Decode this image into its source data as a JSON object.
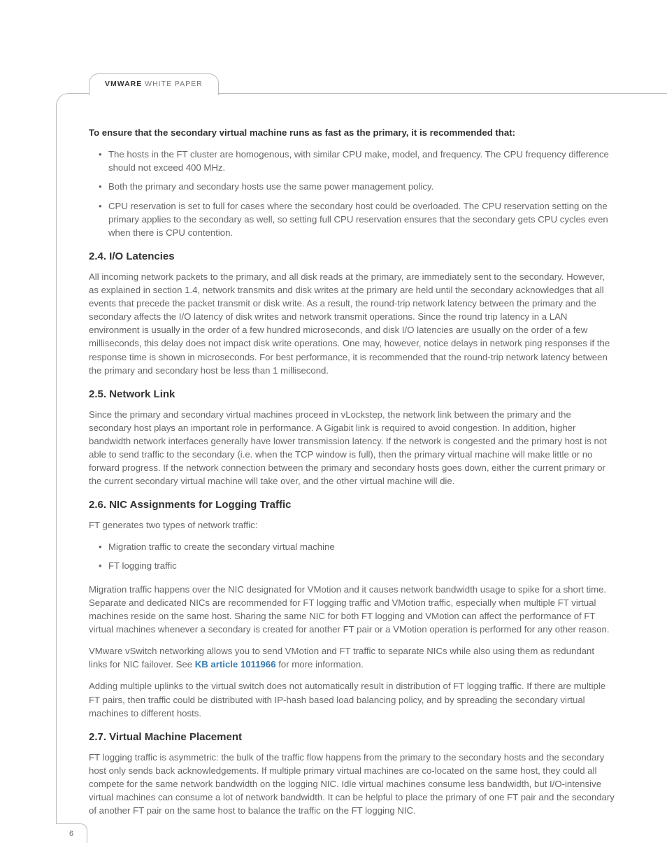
{
  "header": {
    "brand": "VMWARE",
    "doctype": "WHITE PAPER"
  },
  "intro": "To ensure that the secondary virtual machine runs as fast as the primary, it is recommended that:",
  "intro_items": [
    "The hosts in the FT cluster are homogenous, with similar CPU make, model, and frequency. The CPU frequency difference should not exceed 400 MHz.",
    "Both the primary and secondary hosts use the same power management policy.",
    "CPU reservation is set to full for cases where the secondary host could be overloaded. The CPU reservation setting on the primary applies to the secondary as well, so setting full CPU reservation ensures that the secondary gets CPU cycles even when there is CPU contention."
  ],
  "s24": {
    "title": "2.4. I/O Latencies",
    "body": "All incoming network packets to the primary, and all disk reads at the primary, are immediately sent to the secondary. However, as explained in section 1.4, network transmits and disk writes at the primary are held until the secondary acknowledges that all events that precede the packet transmit or disk write. As a result, the round-trip network latency between the primary and the secondary affects the I/O latency of disk writes and network transmit operations. Since the round trip latency in a LAN environment is usually in the order of a few hundred microseconds, and disk I/O latencies are usually on the order of a few milliseconds, this delay does not impact disk write operations. One may, however, notice delays in network ping responses if the response time is shown in microseconds. For best performance, it is recommended that the round-trip network latency between the primary and secondary host be less than 1 millisecond."
  },
  "s25": {
    "title": "2.5. Network Link",
    "body": "Since the primary and secondary virtual machines proceed in vLockstep, the network link between the primary and the secondary host plays an important role in performance. A Gigabit link is required to avoid congestion. In addition, higher bandwidth network interfaces generally have lower transmission latency. If the network is congested and the primary host is not able to send traffic to the secondary (i.e. when the TCP window is full), then the primary virtual machine will make little or no forward progress. If the network connection between the primary and secondary hosts goes down, either the current primary or the current secondary virtual machine will take over, and the other virtual machine will die."
  },
  "s26": {
    "title": "2.6. NIC Assignments for Logging Traffic",
    "lead": "FT generates two types of network traffic:",
    "items": [
      "Migration traffic to create the secondary virtual machine",
      "FT logging traffic"
    ],
    "p1": "Migration traffic happens over the NIC designated for VMotion and it causes network bandwidth usage to spike for a short time. Separate and dedicated NICs are recommended for FT logging traffic and VMotion traffic, especially when multiple FT virtual machines reside on the same host. Sharing the same NIC for both FT logging and VMotion can affect the performance of FT virtual machines whenever a secondary is created for another FT pair or a VMotion operation is performed for any other reason.",
    "p2a": "VMware vSwitch networking allows you to send VMotion and FT traffic to separate NICs while also using them as redundant links for NIC failover. See ",
    "p2link": "KB article 1011966",
    "p2b": " for more information.",
    "p3": "Adding multiple uplinks to the virtual switch does not automatically result in distribution of FT logging traffic. If there are multiple FT pairs, then traffic could be distributed with IP-hash based load balancing policy, and by spreading the secondary virtual machines to different hosts."
  },
  "s27": {
    "title": "2.7. Virtual Machine Placement",
    "body": "FT logging traffic is asymmetric: the bulk of the traffic flow happens from the primary to the secondary hosts and the secondary host only sends back acknowledgements. If multiple primary virtual machines are co-located on the same host, they could all compete for the same network bandwidth on the logging NIC. Idle virtual machines consume less bandwidth, but I/O-intensive virtual machines can consume a lot of network bandwidth. It can be helpful to place the primary of one FT pair and the secondary of another FT pair on the same host to balance the traffic on the FT logging NIC."
  },
  "page_number": "6"
}
